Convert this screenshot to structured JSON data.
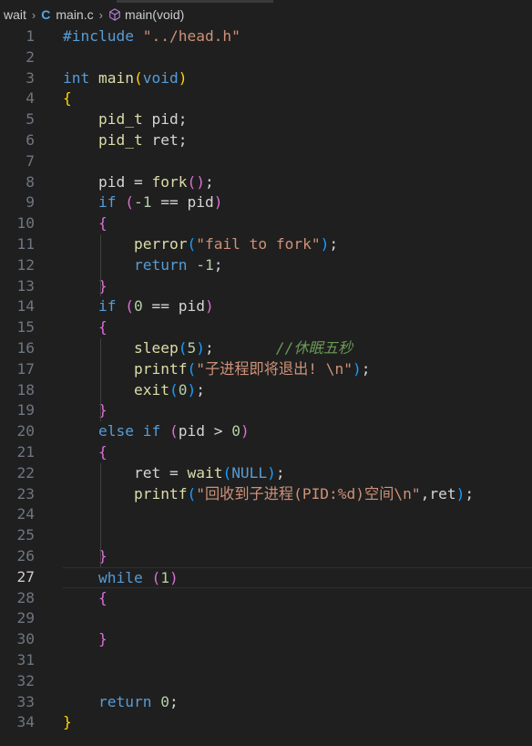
{
  "breadcrumb": {
    "folder": "wait",
    "file": "main.c",
    "symbol": "main(void)"
  },
  "editor": {
    "current_line": 27,
    "lines": [
      [
        {
          "t": "#include ",
          "c": "kw"
        },
        {
          "t": "\"../head.h\"",
          "c": "str"
        }
      ],
      [],
      [
        {
          "t": "int ",
          "c": "kw"
        },
        {
          "t": "main",
          "c": "fn"
        },
        {
          "t": "(",
          "c": "br1"
        },
        {
          "t": "void",
          "c": "kw"
        },
        {
          "t": ")",
          "c": "br1"
        }
      ],
      [
        {
          "t": "{",
          "c": "br1"
        }
      ],
      [
        {
          "t": "    "
        },
        {
          "t": "pid_t",
          "c": "ty2"
        },
        {
          "t": " pid;",
          "c": "plain"
        }
      ],
      [
        {
          "t": "    "
        },
        {
          "t": "pid_t",
          "c": "ty2"
        },
        {
          "t": " ret;",
          "c": "plain"
        }
      ],
      [],
      [
        {
          "t": "    pid = ",
          "c": "plain"
        },
        {
          "t": "fork",
          "c": "fn"
        },
        {
          "t": "()",
          "c": "br2"
        },
        {
          "t": ";",
          "c": "plain"
        }
      ],
      [
        {
          "t": "    "
        },
        {
          "t": "if",
          "c": "kw"
        },
        {
          "t": " "
        },
        {
          "t": "(",
          "c": "br2"
        },
        {
          "t": "-1",
          "c": "num"
        },
        {
          "t": " == pid",
          "c": "plain"
        },
        {
          "t": ")",
          "c": "br2"
        }
      ],
      [
        {
          "t": "    "
        },
        {
          "t": "{",
          "c": "br2"
        }
      ],
      [
        {
          "t": "        "
        },
        {
          "t": "perror",
          "c": "fn"
        },
        {
          "t": "(",
          "c": "br3"
        },
        {
          "t": "\"fail to fork\"",
          "c": "str"
        },
        {
          "t": ")",
          "c": "br3"
        },
        {
          "t": ";",
          "c": "plain"
        }
      ],
      [
        {
          "t": "        "
        },
        {
          "t": "return",
          "c": "kw"
        },
        {
          "t": " "
        },
        {
          "t": "-1",
          "c": "num"
        },
        {
          "t": ";",
          "c": "plain"
        }
      ],
      [
        {
          "t": "    "
        },
        {
          "t": "}",
          "c": "br2"
        }
      ],
      [
        {
          "t": "    "
        },
        {
          "t": "if",
          "c": "kw"
        },
        {
          "t": " "
        },
        {
          "t": "(",
          "c": "br2"
        },
        {
          "t": "0",
          "c": "num"
        },
        {
          "t": " == pid",
          "c": "plain"
        },
        {
          "t": ")",
          "c": "br2"
        }
      ],
      [
        {
          "t": "    "
        },
        {
          "t": "{",
          "c": "br2"
        }
      ],
      [
        {
          "t": "        "
        },
        {
          "t": "sleep",
          "c": "fn"
        },
        {
          "t": "(",
          "c": "br3"
        },
        {
          "t": "5",
          "c": "num"
        },
        {
          "t": ")",
          "c": "br3"
        },
        {
          "t": ";       ",
          "c": "plain"
        },
        {
          "t": "//休眠五秒",
          "c": "cm"
        }
      ],
      [
        {
          "t": "        "
        },
        {
          "t": "printf",
          "c": "fn"
        },
        {
          "t": "(",
          "c": "br3"
        },
        {
          "t": "\"子进程即将退出! \\n\"",
          "c": "str"
        },
        {
          "t": ")",
          "c": "br3"
        },
        {
          "t": ";",
          "c": "plain"
        }
      ],
      [
        {
          "t": "        "
        },
        {
          "t": "exit",
          "c": "fn"
        },
        {
          "t": "(",
          "c": "br3"
        },
        {
          "t": "0",
          "c": "num"
        },
        {
          "t": ")",
          "c": "br3"
        },
        {
          "t": ";",
          "c": "plain"
        }
      ],
      [
        {
          "t": "    "
        },
        {
          "t": "}",
          "c": "br2"
        }
      ],
      [
        {
          "t": "    "
        },
        {
          "t": "else if",
          "c": "kw"
        },
        {
          "t": " "
        },
        {
          "t": "(",
          "c": "br2"
        },
        {
          "t": "pid > ",
          "c": "plain"
        },
        {
          "t": "0",
          "c": "num"
        },
        {
          "t": ")",
          "c": "br2"
        }
      ],
      [
        {
          "t": "    "
        },
        {
          "t": "{",
          "c": "br2"
        }
      ],
      [
        {
          "t": "        ret = ",
          "c": "plain"
        },
        {
          "t": "wait",
          "c": "fn"
        },
        {
          "t": "(",
          "c": "br3"
        },
        {
          "t": "NULL",
          "c": "kw"
        },
        {
          "t": ")",
          "c": "br3"
        },
        {
          "t": ";",
          "c": "plain"
        }
      ],
      [
        {
          "t": "        "
        },
        {
          "t": "printf",
          "c": "fn"
        },
        {
          "t": "(",
          "c": "br3"
        },
        {
          "t": "\"回收到子进程(PID:%d)空间\\n\"",
          "c": "str"
        },
        {
          "t": ",ret",
          "c": "plain"
        },
        {
          "t": ")",
          "c": "br3"
        },
        {
          "t": ";",
          "c": "plain"
        }
      ],
      [],
      [],
      [
        {
          "t": "    "
        },
        {
          "t": "}",
          "c": "br2"
        }
      ],
      [
        {
          "t": "    "
        },
        {
          "t": "while",
          "c": "kw"
        },
        {
          "t": " "
        },
        {
          "t": "(",
          "c": "br2"
        },
        {
          "t": "1",
          "c": "num"
        },
        {
          "t": ")",
          "c": "br2"
        }
      ],
      [
        {
          "t": "    "
        },
        {
          "t": "{",
          "c": "br2"
        }
      ],
      [],
      [
        {
          "t": "    "
        },
        {
          "t": "}",
          "c": "br2"
        }
      ],
      [],
      [],
      [
        {
          "t": "    "
        },
        {
          "t": "return",
          "c": "kw"
        },
        {
          "t": " "
        },
        {
          "t": "0",
          "c": "num"
        },
        {
          "t": ";",
          "c": "plain"
        }
      ],
      [
        {
          "t": "}",
          "c": "br1"
        }
      ]
    ]
  }
}
